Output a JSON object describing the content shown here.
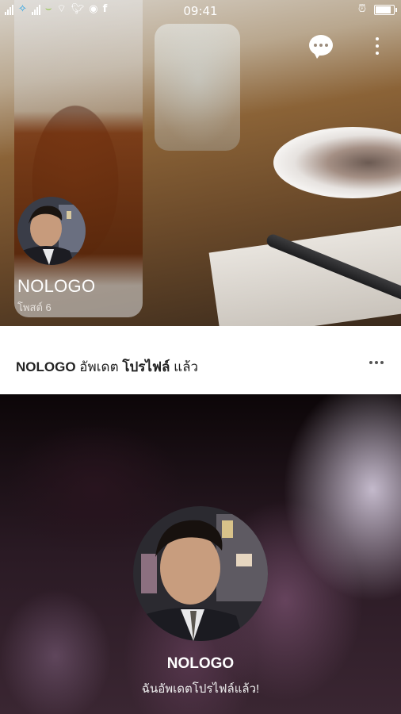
{
  "status_bar": {
    "time": "09:41",
    "icons": [
      "signal-icon",
      "dtac-icon",
      "signal-icon",
      "line-carrier-icon",
      "wifi-icon",
      "twitter-icon",
      "messenger-icon",
      "facebook-icon",
      "alarm-icon",
      "battery-icon"
    ],
    "battery_level": 0.95
  },
  "cover": {
    "profile_name": "NOLOGO",
    "posts_label": "โพสต์ 6"
  },
  "update": {
    "name": "NOLOGO",
    "action": "อัพเดต",
    "target": "โปรไฟล์",
    "suffix": "แล้ว"
  },
  "post": {
    "name": "NOLOGO",
    "message": "ฉันอัพเดตโปรไฟล์แล้ว!"
  }
}
